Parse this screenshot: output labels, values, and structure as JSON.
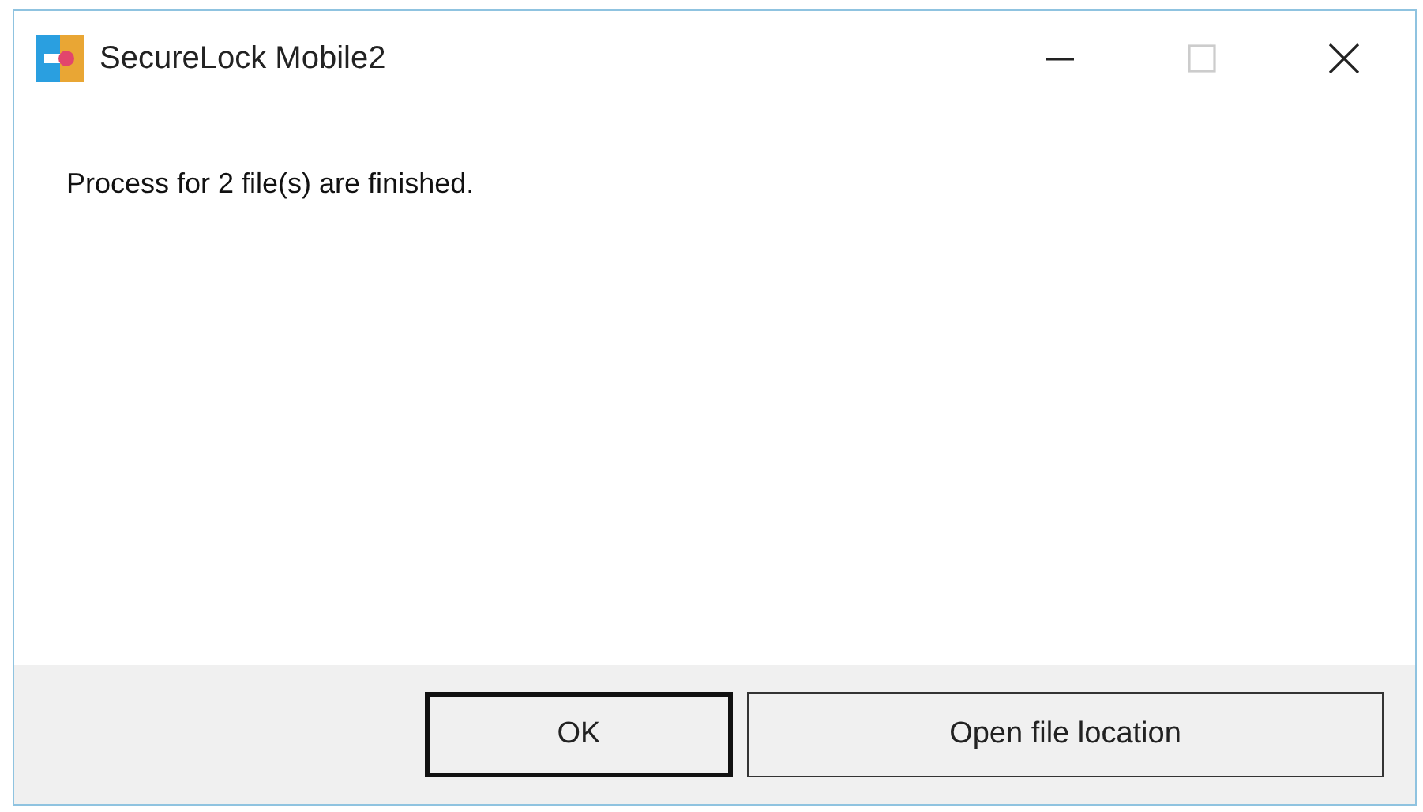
{
  "window": {
    "title": "SecureLock Mobile2",
    "controls": [
      {
        "kind": "minimize",
        "disabled": false
      },
      {
        "kind": "maximize",
        "disabled": true
      },
      {
        "kind": "close",
        "disabled": false
      }
    ]
  },
  "message": "Process for 2 file(s) are finished.",
  "buttons": [
    {
      "label": "OK",
      "default": true
    },
    {
      "label": "Open file location",
      "default": false
    }
  ]
}
